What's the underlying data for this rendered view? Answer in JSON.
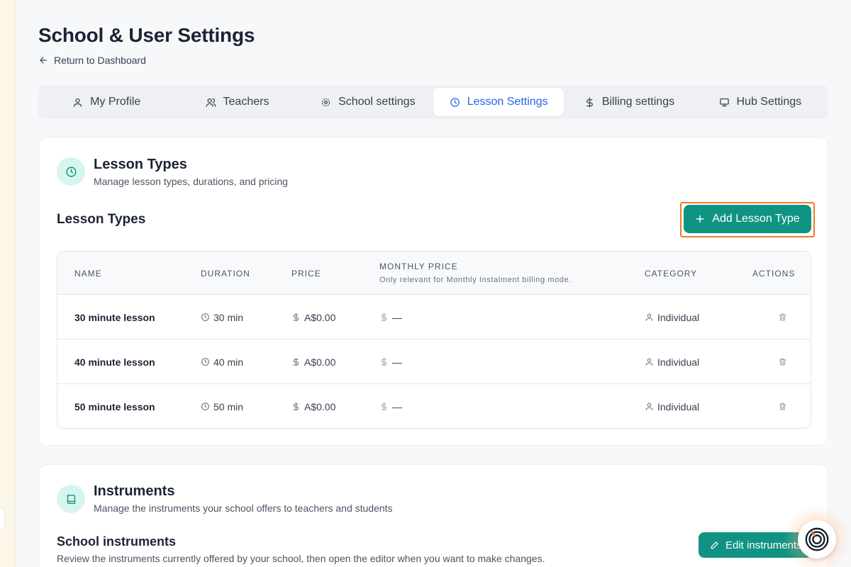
{
  "page": {
    "title": "School & User Settings",
    "back_label": "Return to Dashboard"
  },
  "tabs": [
    {
      "label": "My Profile",
      "icon": "user-icon"
    },
    {
      "label": "Teachers",
      "icon": "users-icon"
    },
    {
      "label": "School settings",
      "icon": "gear-icon"
    },
    {
      "label": "Lesson Settings",
      "icon": "clock-icon",
      "active": true
    },
    {
      "label": "Billing settings",
      "icon": "dollar-icon"
    },
    {
      "label": "Hub Settings",
      "icon": "monitor-icon"
    }
  ],
  "lesson_types_card": {
    "title": "Lesson Types",
    "subtitle": "Manage lesson types, durations, and pricing",
    "section_title": "Lesson Types",
    "add_button": "Add Lesson Type",
    "columns": {
      "name": "NAME",
      "duration": "DURATION",
      "price": "PRICE",
      "monthly_price": "MONTHLY PRICE",
      "monthly_note": "Only relevant for Monthly Instalment billing mode.",
      "category": "CATEGORY",
      "actions": "ACTIONS"
    },
    "rows": [
      {
        "name": "30 minute lesson",
        "duration": "30 min",
        "price": "A$0.00",
        "monthly": "—",
        "category": "Individual"
      },
      {
        "name": "40 minute lesson",
        "duration": "40 min",
        "price": "A$0.00",
        "monthly": "—",
        "category": "Individual"
      },
      {
        "name": "50 minute lesson",
        "duration": "50 min",
        "price": "A$0.00",
        "monthly": "—",
        "category": "Individual"
      }
    ]
  },
  "instruments_card": {
    "title": "Instruments",
    "subtitle": "Manage the instruments your school offers to teachers and students",
    "section_title": "School instruments",
    "section_desc": "Review the instruments currently offered by your school, then open the editor when you want to make changes.",
    "edit_button": "Edit instruments"
  },
  "colors": {
    "accent": "#109383",
    "active_tab": "#2563eb",
    "highlight": "#ef7d22"
  }
}
